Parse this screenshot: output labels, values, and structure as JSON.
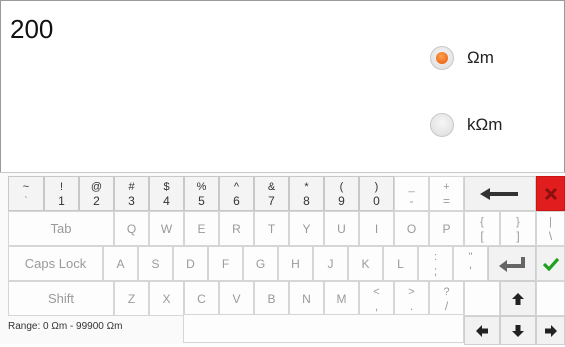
{
  "display": {
    "value": "200"
  },
  "units": [
    {
      "label": "Ωm",
      "selected": true
    },
    {
      "label": "kΩm",
      "selected": false
    }
  ],
  "status": {
    "range_text": "Range: 0 Ωm - 99900 Ωm"
  },
  "keyboard": {
    "row1": [
      {
        "top": "~",
        "bot": "`"
      },
      {
        "top": "!",
        "bot": "1"
      },
      {
        "top": "@",
        "bot": "2"
      },
      {
        "top": "#",
        "bot": "3"
      },
      {
        "top": "$",
        "bot": "4"
      },
      {
        "top": "%",
        "bot": "5"
      },
      {
        "top": "^",
        "bot": "6"
      },
      {
        "top": "&",
        "bot": "7"
      },
      {
        "top": "*",
        "bot": "8"
      },
      {
        "top": "(",
        "bot": "9"
      },
      {
        "top": ")",
        "bot": "0"
      },
      {
        "top": "_",
        "bot": "-"
      },
      {
        "top": "+",
        "bot": "="
      }
    ],
    "row2_tab": "Tab",
    "row2": [
      "Q",
      "W",
      "E",
      "R",
      "T",
      "Y",
      "U",
      "I",
      "O",
      "P"
    ],
    "row2_sym": [
      {
        "top": "{",
        "bot": "["
      },
      {
        "top": "}",
        "bot": "]"
      },
      {
        "top": "|",
        "bot": "\\"
      }
    ],
    "row3_caps": "Caps Lock",
    "row3": [
      "A",
      "S",
      "D",
      "F",
      "G",
      "H",
      "J",
      "K",
      "L"
    ],
    "row3_sym": [
      {
        "top": ":",
        "bot": ";"
      },
      {
        "top": "\"",
        "bot": "'"
      }
    ],
    "row4_shift": "Shift",
    "row4": [
      "Z",
      "X",
      "C",
      "V",
      "B",
      "N",
      "M"
    ],
    "row4_sym": [
      {
        "top": "<",
        "bot": ","
      },
      {
        "top": ">",
        "bot": "."
      },
      {
        "top": "?",
        "bot": "/"
      }
    ],
    "icons": {
      "backspace": "backspace-arrow-icon",
      "close": "close-icon",
      "enter": "enter-icon",
      "confirm": "checkmark-icon",
      "shift_up": "arrow-up-icon",
      "left": "arrow-left-icon",
      "down": "arrow-down-icon",
      "right": "arrow-right-icon"
    },
    "colors": {
      "close_bg": "#e21d1d",
      "check": "#1fa01f",
      "radio_on": "#f0620f"
    }
  }
}
